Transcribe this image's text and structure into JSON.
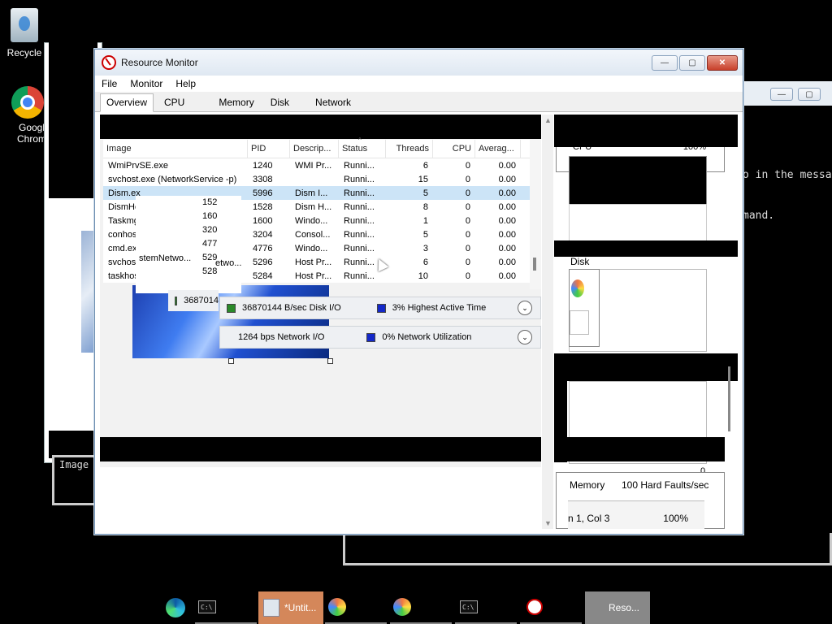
{
  "desktop": {
    "icons": [
      {
        "label": "Recycle"
      },
      {
        "label": "Googl Chrom"
      }
    ]
  },
  "background_text": {
    "message_fragment": "o in the messag",
    "command_fragment": "mand.",
    "image_fragment": "Image"
  },
  "window": {
    "title": "Resource Monitor",
    "menu": [
      "File",
      "Monitor",
      "Help"
    ],
    "tabs": [
      "Overview",
      "CPU",
      "Memory",
      "Disk",
      "Network"
    ],
    "active_tab": "Overview"
  },
  "process_table": {
    "headers": [
      "Image",
      "PID",
      "Descrip...",
      "Status",
      "Threads",
      "CPU",
      "Averag..."
    ],
    "rows": [
      [
        "WmiPrvSE.exe",
        "1240",
        "WMI Pr...",
        "Runni...",
        "6",
        "0",
        "0.00"
      ],
      [
        "svchost.exe (NetworkService -p)",
        "3308",
        "",
        "Runni...",
        "15",
        "0",
        "0.00"
      ],
      [
        "Dism.ex",
        "5996",
        "Dism I...",
        "Runni...",
        "5",
        "0",
        "0.00"
      ],
      [
        "DismHc",
        "1528",
        "Dism H...",
        "Runni...",
        "8",
        "0",
        "0.00"
      ],
      [
        "Taskmg",
        "1600",
        "Windo...",
        "Runni...",
        "1",
        "0",
        "0.00"
      ],
      [
        "conhos",
        "3204",
        "Consol...",
        "Runni...",
        "5",
        "0",
        "0.00"
      ],
      [
        "cmd.exe",
        "4776",
        "Windo...",
        "Runni...",
        "3",
        "0",
        "0.00"
      ],
      [
        "svchost",
        "5296",
        "Host Pr...",
        "Runni...",
        "6",
        "0",
        "0.00"
      ],
      [
        "taskhos",
        "5284",
        "Host Pr...",
        "Runni...",
        "10",
        "0",
        "0.00"
      ]
    ],
    "selected_row": 2,
    "overlay_pids": [
      "152",
      "160",
      "320",
      "477",
      "529",
      "528"
    ],
    "overlay_text_1": "stemNetwo...",
    "overlay_text_2": "etwo..."
  },
  "disk_bar": {
    "io": "36870144 B/sec Disk I/O",
    "active": "3% Highest Active Time",
    "ghost": "3687014"
  },
  "network_bar": {
    "io": "1264 bps Network I/O",
    "util": "0% Network Utilization"
  },
  "right_pane": {
    "cpu_label": "CPU",
    "cpu_value": "100%",
    "disk_label": "Disk",
    "zero_label": "0",
    "memory_label": "Memory",
    "memory_value": "100 Hard Faults/sec",
    "notepad_pos": "n 1, Col 3",
    "notepad_zoom": "100%"
  },
  "taskbar": {
    "notepad_label": "*Untit...",
    "rm_label": "Reso..."
  }
}
